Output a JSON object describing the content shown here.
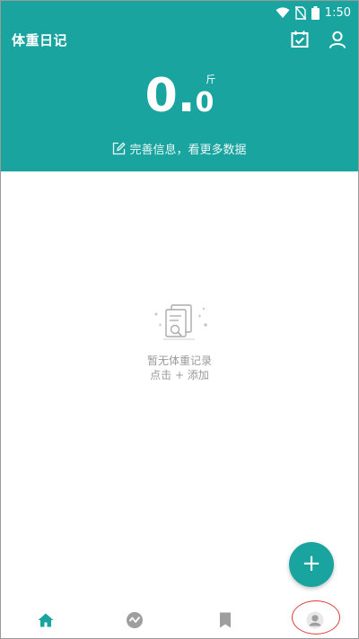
{
  "status_bar": {
    "time": "1:50",
    "icons": [
      "wifi-icon",
      "no-sim-icon",
      "battery-icon"
    ]
  },
  "header": {
    "title": "体重日记",
    "icons": [
      "calendar-check-icon",
      "person-icon"
    ]
  },
  "weight": {
    "integer": "0",
    "dot": ".",
    "decimal": "0",
    "unit": "斤"
  },
  "info_link": {
    "icon": "edit-icon",
    "text": "完善信息，看更多数据"
  },
  "empty_state": {
    "icon": "empty-records-icon",
    "line1": "暂无体重记录",
    "line2": "点击 + 添加"
  },
  "fab": {
    "label": "+"
  },
  "bottom_nav": {
    "items": [
      "home-icon",
      "trend-icon",
      "bookmark-icon",
      "profile-icon"
    ],
    "active": "home-icon"
  },
  "colors": {
    "brand": "#1aa4a0",
    "annotation": "#e23a3a"
  }
}
